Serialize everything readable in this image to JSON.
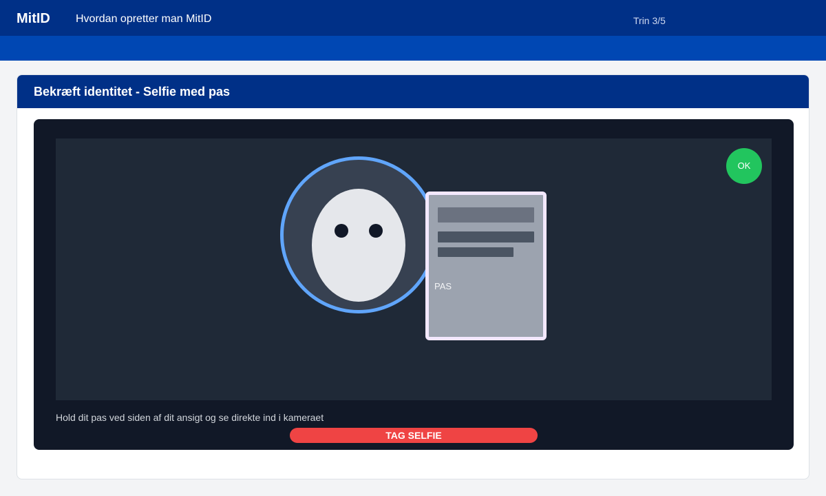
{
  "app": {
    "brand": "MitID",
    "title": "Hvordan opretter man MitID",
    "step": "Trin 3/5"
  },
  "card": {
    "title": "Bekræft identitet - Selfie med pas"
  },
  "camera": {
    "passport_label": "PAS",
    "status_badge": "OK",
    "instructions": "Hold dit pas ved siden af dit ansigt og se direkte ind i kameraet",
    "capture_button": "TAG SELFIE"
  },
  "colors": {
    "primary": "#003087",
    "secondary": "#0047b3",
    "face_frame": "#60a5fa",
    "passport_frame": "#f3e8ff",
    "ok": "#22c55e",
    "capture": "#ef4444"
  },
  "icons": {
    "face": "face-silhouette-icon",
    "passport": "passport-icon"
  }
}
